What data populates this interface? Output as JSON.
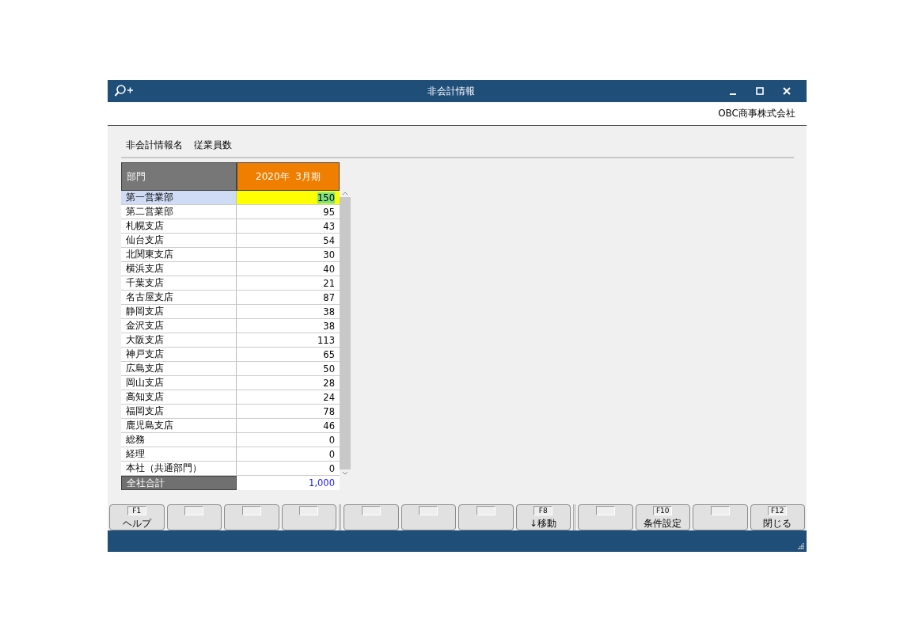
{
  "window": {
    "title": "非会計情報"
  },
  "company": "OBC商事株式会社",
  "info": {
    "label": "非会計情報名",
    "value": "従業員数"
  },
  "table": {
    "columns": [
      "部門",
      "2020年  3月期"
    ],
    "rows": [
      {
        "name": "第一営業部",
        "value": "150",
        "selected": true
      },
      {
        "name": "第二営業部",
        "value": "95",
        "selected": false
      },
      {
        "name": "札幌支店",
        "value": "43",
        "selected": false
      },
      {
        "name": "仙台支店",
        "value": "54",
        "selected": false
      },
      {
        "name": "北関東支店",
        "value": "30",
        "selected": false
      },
      {
        "name": "横浜支店",
        "value": "40",
        "selected": false
      },
      {
        "name": "千葉支店",
        "value": "21",
        "selected": false
      },
      {
        "name": "名古屋支店",
        "value": "87",
        "selected": false
      },
      {
        "name": "静岡支店",
        "value": "38",
        "selected": false
      },
      {
        "name": "金沢支店",
        "value": "38",
        "selected": false
      },
      {
        "name": "大阪支店",
        "value": "113",
        "selected": false
      },
      {
        "name": "神戸支店",
        "value": "65",
        "selected": false
      },
      {
        "name": "広島支店",
        "value": "50",
        "selected": false
      },
      {
        "name": "岡山支店",
        "value": "28",
        "selected": false
      },
      {
        "name": "高知支店",
        "value": "24",
        "selected": false
      },
      {
        "name": "福岡支店",
        "value": "78",
        "selected": false
      },
      {
        "name": "鹿児島支店",
        "value": "46",
        "selected": false
      },
      {
        "name": "総務",
        "value": "0",
        "selected": false
      },
      {
        "name": "経理",
        "value": "0",
        "selected": false
      },
      {
        "name": "本社（共通部門）",
        "value": "0",
        "selected": false
      }
    ],
    "total": {
      "name": "全社合計",
      "value": "1,000"
    }
  },
  "function_keys": [
    {
      "kind": "labeled",
      "key": "F1",
      "label": "ヘルプ"
    },
    {
      "kind": "blank"
    },
    {
      "kind": "blank"
    },
    {
      "kind": "blank"
    },
    {
      "kind": "blank"
    },
    {
      "kind": "blank"
    },
    {
      "kind": "blank"
    },
    {
      "kind": "labeled",
      "key": "F8",
      "label": "↓移動"
    },
    {
      "kind": "blank"
    },
    {
      "kind": "labeled",
      "key": "F10",
      "label": "条件設定"
    },
    {
      "kind": "blank"
    },
    {
      "kind": "labeled",
      "key": "F12",
      "label": "閉じる"
    }
  ]
}
